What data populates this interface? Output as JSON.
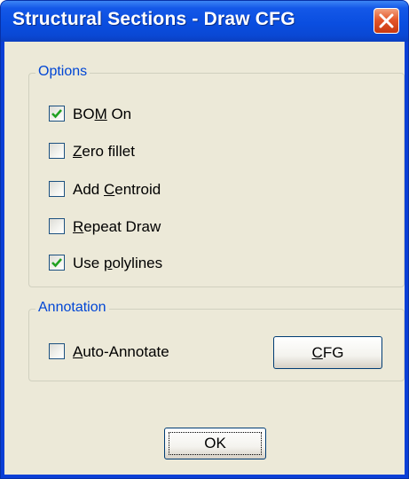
{
  "window": {
    "title": "Structural Sections - Draw CFG",
    "close_icon": "close-icon"
  },
  "options_group": {
    "legend": "Options",
    "items": [
      {
        "pre": "BO",
        "mn": "M",
        "post": " On",
        "checked": true
      },
      {
        "pre": "",
        "mn": "Z",
        "post": "ero fillet",
        "checked": false
      },
      {
        "pre": "Add ",
        "mn": "C",
        "post": "entroid",
        "checked": false
      },
      {
        "pre": "",
        "mn": "R",
        "post": "epeat Draw",
        "checked": false
      },
      {
        "pre": "Use ",
        "mn": "p",
        "post": "olylines",
        "checked": true
      }
    ]
  },
  "annotation_group": {
    "legend": "Annotation",
    "auto_annotate": {
      "pre": "",
      "mn": "A",
      "post": "uto-Annotate",
      "checked": false
    },
    "cfg_button": {
      "mn": "C",
      "post": "FG"
    }
  },
  "ok_button": {
    "label": "OK"
  },
  "colors": {
    "title_bar": "#0a4ee0",
    "client": "#ece9d8",
    "legend": "#0046d5",
    "check": "#21a121"
  }
}
